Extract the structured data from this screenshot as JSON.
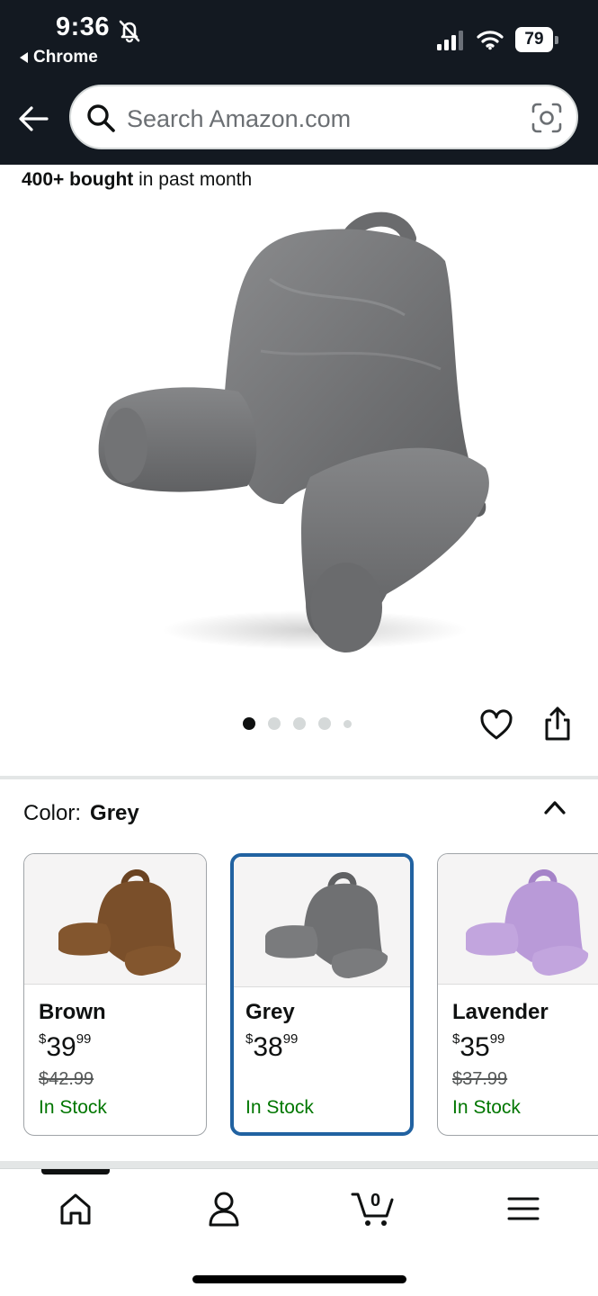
{
  "status_bar": {
    "time": "9:36",
    "back_app": "Chrome",
    "battery": "79",
    "icons": [
      "bell-slash-icon",
      "signal-icon",
      "wifi-icon",
      "battery-icon"
    ]
  },
  "header": {
    "search_placeholder": "Search Amazon.com",
    "icons": [
      "back-arrow-icon",
      "search-icon",
      "lens-camera-icon"
    ]
  },
  "product": {
    "bought_bold": "400+ bought",
    "bought_rest": " in past month",
    "image_dots": 5,
    "active_dot": 0,
    "icons": [
      "heart-icon",
      "share-icon"
    ]
  },
  "color_selector": {
    "label": "Color:",
    "selected": "Grey",
    "expanded": true,
    "options": [
      {
        "name": "Brown",
        "price_whole": "39",
        "price_fraction": "99",
        "currency": "$",
        "list_price": "$42.99",
        "stock": "In Stock",
        "color": "#7a4f2a",
        "selected": false
      },
      {
        "name": "Grey",
        "price_whole": "38",
        "price_fraction": "99",
        "currency": "$",
        "list_price": "",
        "stock": "In Stock",
        "color": "#6f7072",
        "selected": true
      },
      {
        "name": "Lavender",
        "price_whole": "35",
        "price_fraction": "99",
        "currency": "$",
        "list_price": "$37.99",
        "stock": "In Stock",
        "color": "#b99ad8",
        "selected": false
      }
    ]
  },
  "bottom_nav": {
    "items": [
      "home-icon",
      "account-icon",
      "cart-icon",
      "menu-icon"
    ],
    "cart_count": "0",
    "active": "home"
  },
  "colors": {
    "header_bg": "#131921",
    "selected_border": "#2162a1",
    "in_stock": "#007600"
  }
}
